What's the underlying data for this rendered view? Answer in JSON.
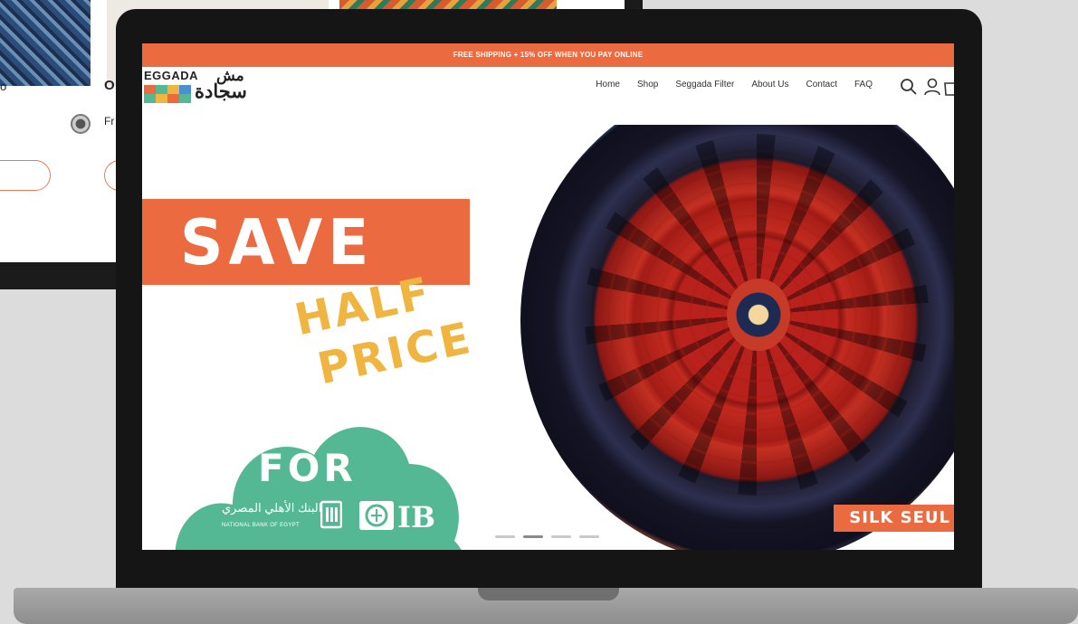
{
  "background_page": {
    "text_left": "o",
    "text_middle": "O",
    "text_fr": "Fr"
  },
  "announcement": {
    "text": "FREE SHIPPING + 15% OFF WHEN YOU PAY ONLINE"
  },
  "brand": {
    "name_en": "EGGADA",
    "name_ar_top": "مش",
    "name_ar": "سجادة"
  },
  "nav": {
    "items": [
      {
        "label": "Home"
      },
      {
        "label": "Shop"
      },
      {
        "label": "Seggada Filter"
      },
      {
        "label": "About Us"
      },
      {
        "label": "Contact"
      },
      {
        "label": "FAQ"
      }
    ]
  },
  "hero": {
    "save": "SAVE",
    "half": "HALF",
    "price": "PRICE",
    "for": "FOR",
    "bank_ar": "البنك الأهلي المصري",
    "bank_en": "NATIONAL BANK OF EGYPT",
    "cib": "CIB",
    "badge": "SILK SEUL",
    "slides": 4,
    "active_slide": 2
  },
  "colors": {
    "accent": "#ec6a3f",
    "yellow": "#f0b541",
    "green": "#55b894"
  }
}
